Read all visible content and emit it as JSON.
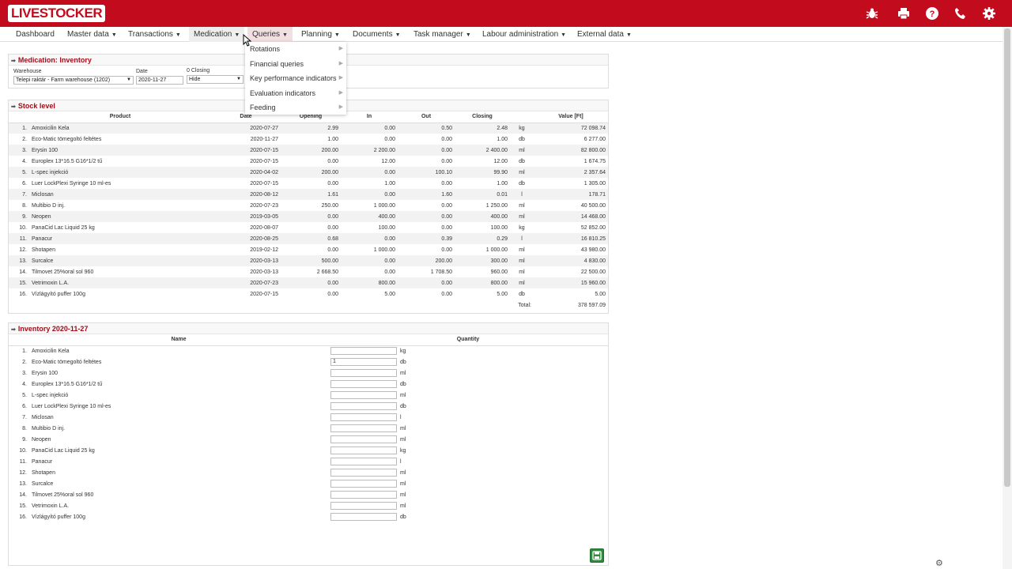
{
  "app": {
    "logo": "LIVESTOCKER",
    "accent": "#c30b1e"
  },
  "topbar_icons": [
    "bug-icon",
    "print-icon",
    "help-icon",
    "phone-icon",
    "gear-icon"
  ],
  "menu": [
    {
      "label": "Dashboard"
    },
    {
      "label": "Master data"
    },
    {
      "label": "Transactions"
    },
    {
      "label": "Medication"
    },
    {
      "label": "Queries"
    },
    {
      "label": "Planning"
    },
    {
      "label": "Documents"
    },
    {
      "label": "Task manager"
    },
    {
      "label": "Labour administration"
    },
    {
      "label": "External data"
    }
  ],
  "queries_menu": [
    "Rotations",
    "Financial queries",
    "Key performance indicators",
    "Evaluation indicators",
    "Feeding"
  ],
  "filter": {
    "title": "Medication: Inventory",
    "warehouse_label": "Warehouse",
    "warehouse_value": "Telepi raktár - Farm warehouse (1202)",
    "date_label": "Date",
    "date_value": "2020-11-27",
    "closing_label": "0 Closing",
    "closing_value": "Hide"
  },
  "stock": {
    "title": "Stock level",
    "headers": [
      "Product",
      "Date",
      "Opening",
      "In",
      "Out",
      "Closing",
      "Value [Ft]"
    ],
    "rows": [
      [
        "1.",
        "Amoxicilin Kela",
        "2020-07-27",
        "2.99",
        "0.00",
        "0.50",
        "2.48",
        "kg",
        "72 098.74"
      ],
      [
        "2.",
        "Eco-Matic tömegoltó feltétes",
        "2020-11-27",
        "1.00",
        "0.00",
        "0.00",
        "1.00",
        "db",
        "6 277.00"
      ],
      [
        "3.",
        "Erysin 100",
        "2020-07-15",
        "200.00",
        "2 200.00",
        "0.00",
        "2 400.00",
        "ml",
        "82 800.00"
      ],
      [
        "4.",
        "Europlex 13*16.5 G16*1/2 tű",
        "2020-07-15",
        "0.00",
        "12.00",
        "0.00",
        "12.00",
        "db",
        "1 674.75"
      ],
      [
        "5.",
        "L-spec injekció",
        "2020-04-02",
        "200.00",
        "0.00",
        "100.10",
        "99.90",
        "ml",
        "2 357.64"
      ],
      [
        "6.",
        "Luer LockPlexi Syringe 10 ml-es",
        "2020-07-15",
        "0.00",
        "1.00",
        "0.00",
        "1.00",
        "db",
        "1 305.00"
      ],
      [
        "7.",
        "Miclosan",
        "2020-08-12",
        "1.61",
        "0.00",
        "1.60",
        "0.01",
        "l",
        "178.71"
      ],
      [
        "8.",
        "Multibio D inj.",
        "2020-07-23",
        "250.00",
        "1 000.00",
        "0.00",
        "1 250.00",
        "ml",
        "40 500.00"
      ],
      [
        "9.",
        "Neopen",
        "2019-03-05",
        "0.00",
        "400.00",
        "0.00",
        "400.00",
        "ml",
        "14 468.00"
      ],
      [
        "10.",
        "PanaCid Lac Liquid 25 kg",
        "2020-08-07",
        "0.00",
        "100.00",
        "0.00",
        "100.00",
        "kg",
        "52 852.00"
      ],
      [
        "11.",
        "Panacur",
        "2020-08-25",
        "0.68",
        "0.00",
        "0.39",
        "0.29",
        "l",
        "16 810.25"
      ],
      [
        "12.",
        "Shotapen",
        "2019-02-12",
        "0.00",
        "1 000.00",
        "0.00",
        "1 000.00",
        "ml",
        "43 980.00"
      ],
      [
        "13.",
        "Surcalce",
        "2020-03-13",
        "500.00",
        "0.00",
        "200.00",
        "300.00",
        "ml",
        "4 830.00"
      ],
      [
        "14.",
        "Tilmovet 25%oral sol 960",
        "2020-03-13",
        "2 668.50",
        "0.00",
        "1 708.50",
        "960.00",
        "ml",
        "22 500.00"
      ],
      [
        "15.",
        "Vetrimoxin L.A.",
        "2020-07-23",
        "0.00",
        "800.00",
        "0.00",
        "800.00",
        "ml",
        "15 960.00"
      ],
      [
        "16.",
        "Vízlágyító puffer 100g",
        "2020-07-15",
        "0.00",
        "5.00",
        "0.00",
        "5.00",
        "db",
        "5.00"
      ]
    ],
    "total_label": "Total:",
    "total_value": "378 597.09"
  },
  "inventory": {
    "title": "Inventory 2020-11-27",
    "headers": [
      "Name",
      "Quantity"
    ],
    "rows": [
      [
        "1.",
        "Amoxicilin Kela",
        "",
        "kg"
      ],
      [
        "2.",
        "Eco-Matic tömegoltó feltétes",
        "1",
        "db"
      ],
      [
        "3.",
        "Erysin 100",
        "",
        "ml"
      ],
      [
        "4.",
        "Europlex 13*16.5 G16*1/2 tű",
        "",
        "db"
      ],
      [
        "5.",
        "L-spec injekció",
        "",
        "ml"
      ],
      [
        "6.",
        "Luer LockPlexi Syringe 10 ml-es",
        "",
        "db"
      ],
      [
        "7.",
        "Miclosan",
        "",
        "l"
      ],
      [
        "8.",
        "Multibio D inj.",
        "",
        "ml"
      ],
      [
        "9.",
        "Neopen",
        "",
        "ml"
      ],
      [
        "10.",
        "PanaCid Lac Liquid 25 kg",
        "",
        "kg"
      ],
      [
        "11.",
        "Panacur",
        "",
        "l"
      ],
      [
        "12.",
        "Shotapen",
        "",
        "ml"
      ],
      [
        "13.",
        "Surcalce",
        "",
        "ml"
      ],
      [
        "14.",
        "Tilmovet 25%oral sol 960",
        "",
        "ml"
      ],
      [
        "15.",
        "Vetrimoxin L.A.",
        "",
        "ml"
      ],
      [
        "16.",
        "Vízlágyító puffer 100g",
        "",
        "db"
      ]
    ]
  }
}
